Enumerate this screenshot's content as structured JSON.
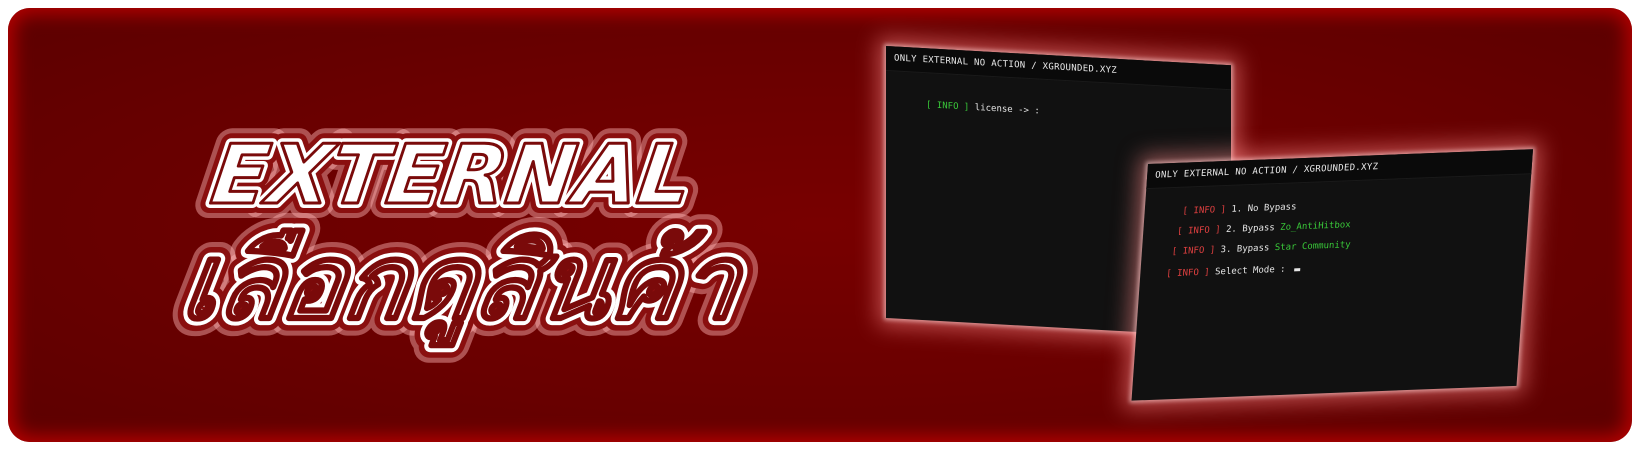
{
  "headline": {
    "line1": "EXTERNAL",
    "line2": "เลือกดูสินค้า"
  },
  "terminal_top": {
    "title": "ONLY EXTERNAL NO ACTION / XGROUNDED.XYZ",
    "lines": [
      {
        "tag": "[ INFO ]",
        "text": "license -> :"
      }
    ]
  },
  "terminal_bottom": {
    "title": "ONLY EXTERNAL NO ACTION / XGROUNDED.XYZ",
    "lines": [
      {
        "tag": "[ INFO ]",
        "text": "1. No Bypass",
        "highlight": ""
      },
      {
        "tag": "[ INFO ]",
        "text": "2. Bypass",
        "highlight": "Zo_AntiHitbox"
      },
      {
        "tag": "[ INFO ]",
        "text": "3. Bypass",
        "highlight": "Star Community"
      },
      {
        "tag": "[ INFO ]",
        "text": "Select Mode :",
        "highlight": ""
      }
    ]
  },
  "colors": {
    "background": "#720000",
    "glow": "#b30000",
    "text_outline": "#8a0f0f",
    "tag_green": "#39c839",
    "tag_red": "#e04040"
  }
}
